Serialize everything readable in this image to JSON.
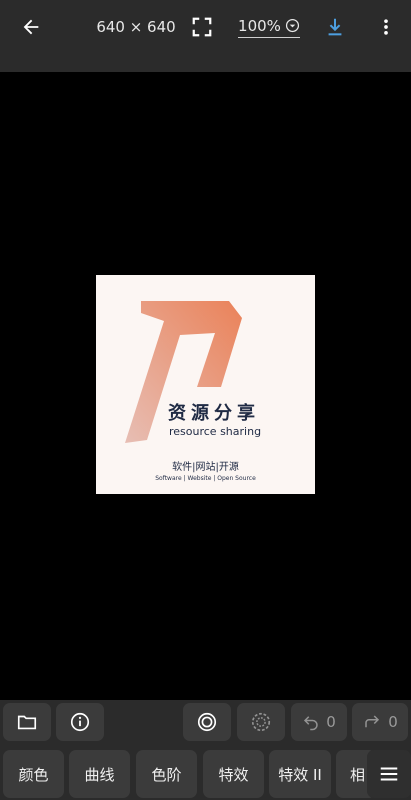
{
  "topbar": {
    "dimensions": "640 × 640",
    "zoom": "100%",
    "icons": [
      "back-arrow-icon",
      "fullscreen-icon",
      "chevron-down-circle-icon",
      "download-icon",
      "more-vert-icon"
    ],
    "accent_color": "#4d9fe0"
  },
  "image": {
    "brand_cn": "资源分享",
    "brand_en": "resource sharing",
    "tagline": "软件|网站|开源",
    "subline": "Software | Website | Open Source"
  },
  "toolbar": {
    "undo_count": "0",
    "redo_count": "0",
    "icons": [
      "folder-icon",
      "info-icon",
      "target-icon",
      "dashed-circle-icon",
      "undo-icon",
      "redo-icon",
      "menu-icon"
    ]
  },
  "tabs": [
    "颜色",
    "曲线",
    "色阶",
    "特效",
    "特效 II",
    "相"
  ]
}
